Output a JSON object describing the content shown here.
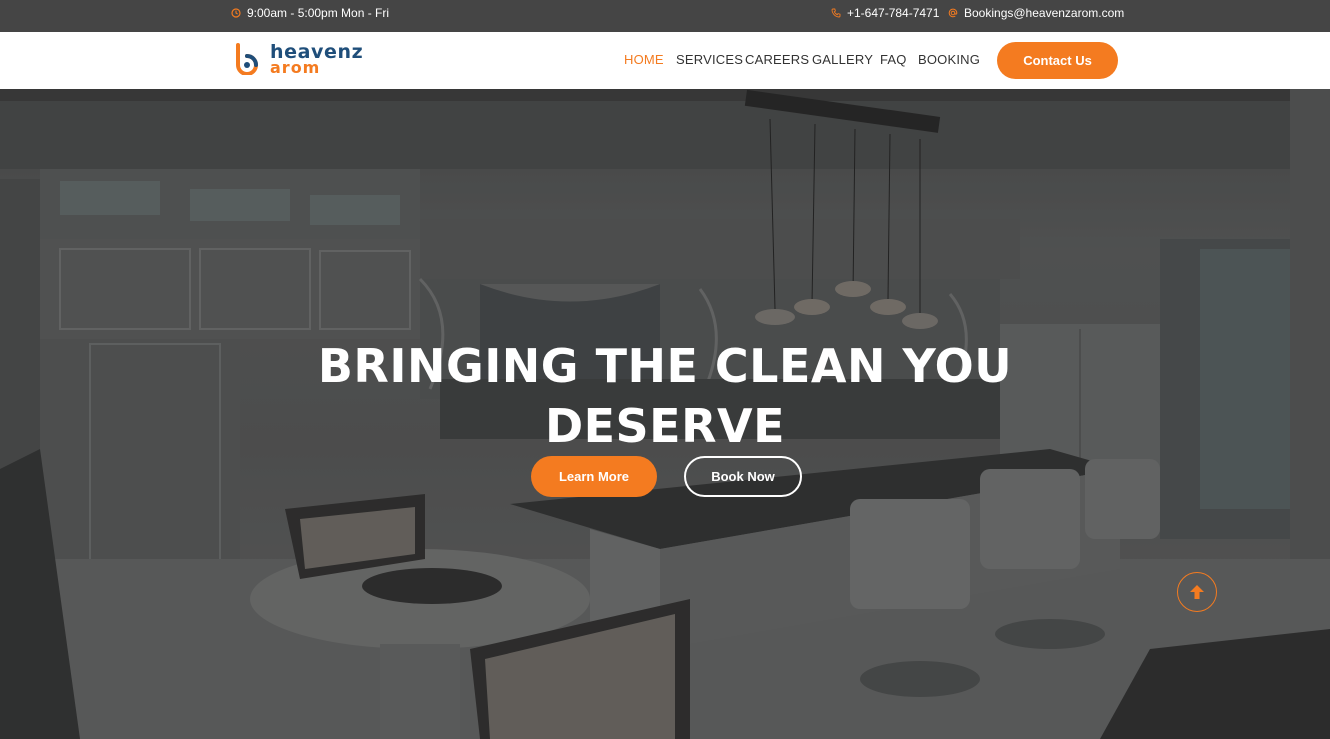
{
  "topbar": {
    "hours": "9:00am - 5:00pm Mon - Fri",
    "phone": "+1-647-784-7471",
    "email": "Bookings@heavenzarom.com",
    "icons": {
      "hours": "clock-icon",
      "phone": "phone-icon",
      "email": "at-icon"
    }
  },
  "logo": {
    "line1": "heavenz",
    "line2": "arom"
  },
  "nav": {
    "items": [
      "HOME",
      "SERVICES",
      "CAREERS",
      "GALLERY",
      "FAQ",
      "BOOKING"
    ],
    "active": "HOME",
    "contact_label": "Contact Us"
  },
  "hero": {
    "title_line1": "BRINGING THE CLEAN YOU",
    "title_line2": "DESERVE",
    "learn_more": "Learn More",
    "book_now": "Book Now"
  },
  "colors": {
    "accent": "#f47b20",
    "brand_blue": "#1f4e7a",
    "topbar_bg": "#454545",
    "text_dark": "#333333"
  }
}
